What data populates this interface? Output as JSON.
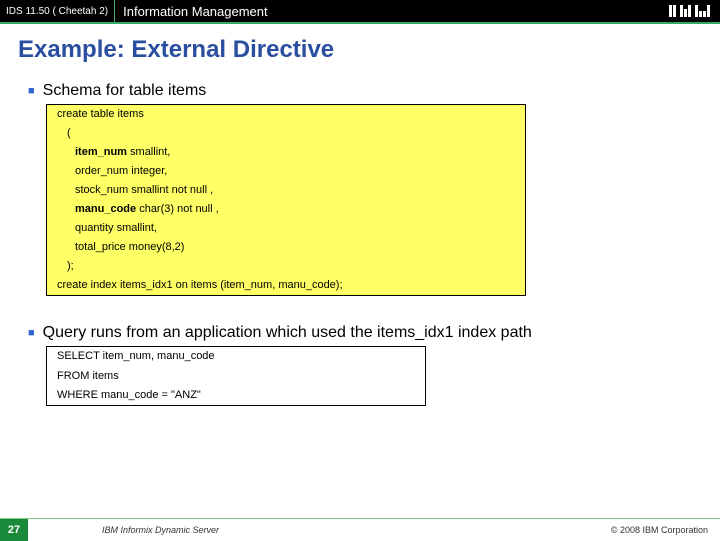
{
  "header": {
    "left": "IDS 11.50 ( Cheetah 2)",
    "title": "Information Management",
    "logo_text": "IBM"
  },
  "slide_title": "Example: External Directive",
  "bullets": {
    "b1": "Schema for table items",
    "b2": "Query runs from an application which used the items_idx1 index path"
  },
  "code1": {
    "l1": "create table items",
    "l2": "(",
    "l3a": "item_num",
    "l3b": " smallint,",
    "l4": "order_num integer,",
    "l5": "stock_num smallint not null ,",
    "l6a": "manu_code",
    "l6b": " char(3) not null ,",
    "l7": "quantity smallint,",
    "l8": "total_price money(8,2)",
    "l9": ");",
    "l10": "create index items_idx1 on items (item_num, manu_code);"
  },
  "code2": {
    "l1": "SELECT item_num, manu_code",
    "l2": "FROM items",
    "l3": "WHERE manu_code = \"ANZ\""
  },
  "footer": {
    "page": "27",
    "mid": "IBM Informix Dynamic Server",
    "right": "© 2008 IBM Corporation"
  }
}
